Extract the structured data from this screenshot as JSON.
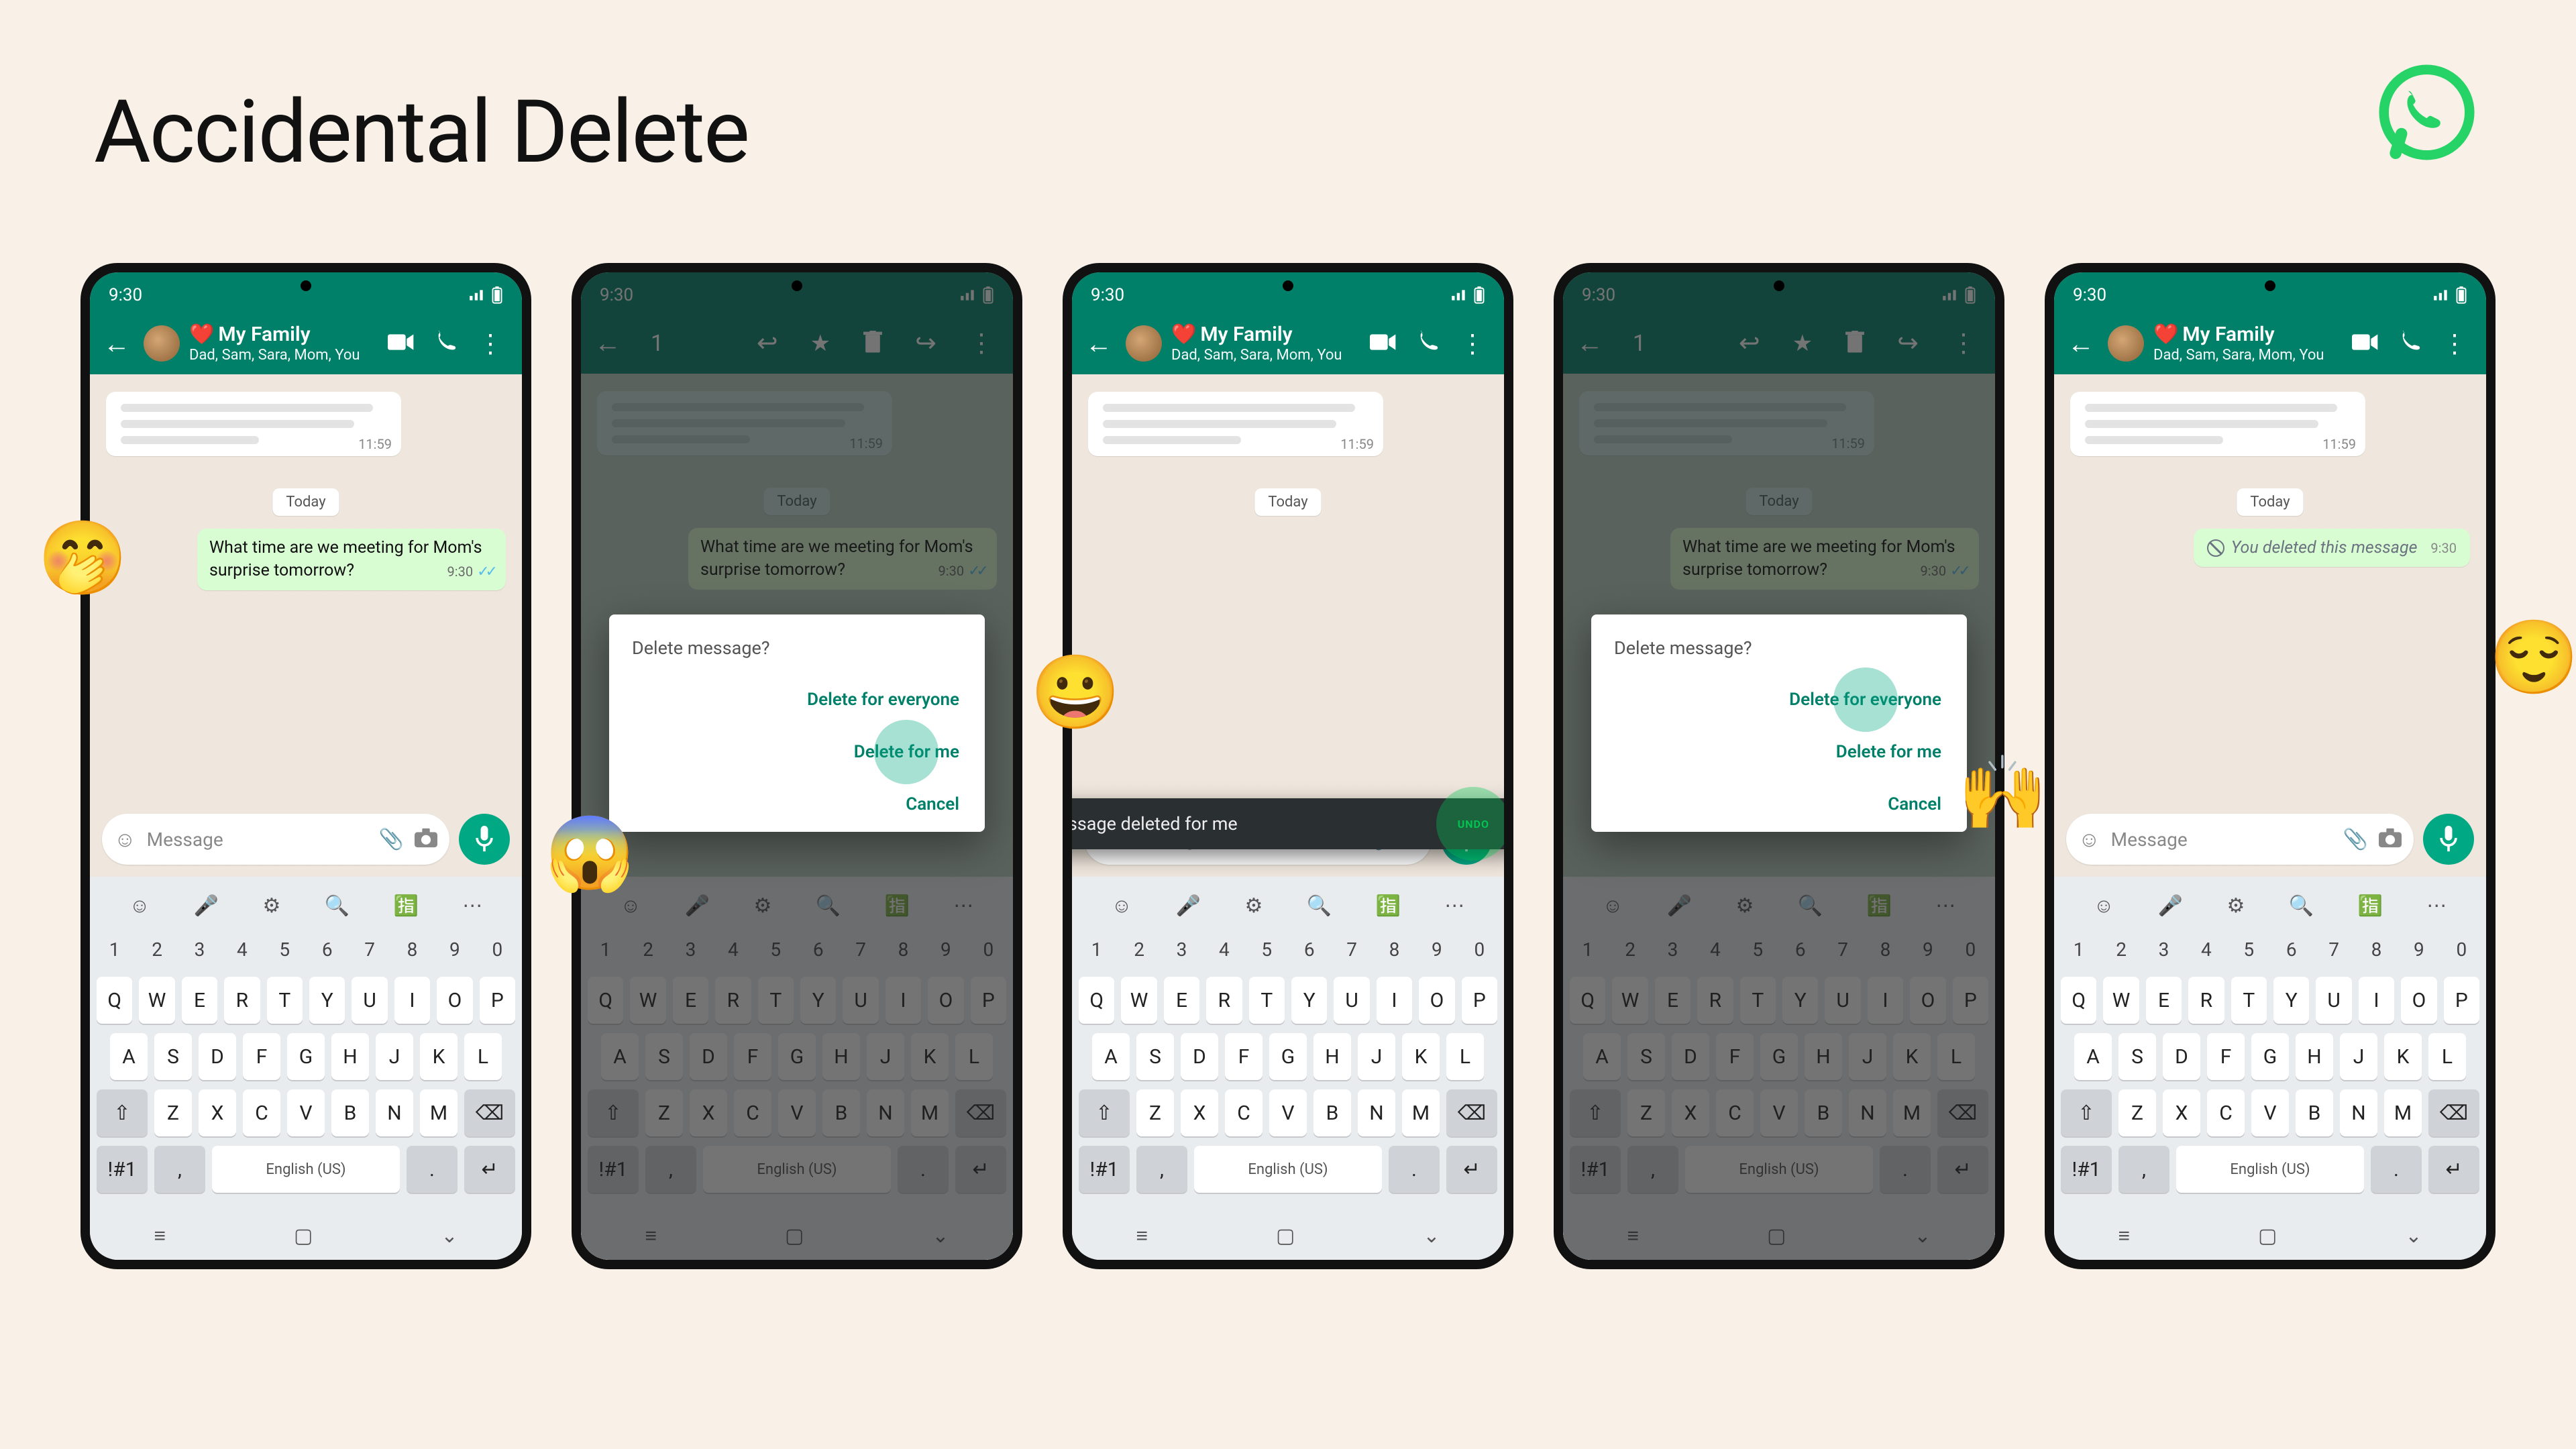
{
  "page_title": "Accidental Delete",
  "statusbar_time": "9:30",
  "chat": {
    "name": "My Family",
    "heart": "❤️",
    "members": "Dad, Sam, Sara, Mom, You"
  },
  "incoming_time": "11:59",
  "day_label": "Today",
  "outgoing_msg": "What time are we meeting for Mom's surprise tomorrow?",
  "outgoing_time": "9:30",
  "deleted_text": "You deleted this message",
  "deleted_time": "9:30",
  "composer_placeholder": "Message",
  "keyboard": {
    "numbers": [
      "1",
      "2",
      "3",
      "4",
      "5",
      "6",
      "7",
      "8",
      "9",
      "0"
    ],
    "row1": [
      "Q",
      "W",
      "E",
      "R",
      "T",
      "Y",
      "U",
      "I",
      "O",
      "P"
    ],
    "row2": [
      "A",
      "S",
      "D",
      "F",
      "G",
      "H",
      "J",
      "K",
      "L"
    ],
    "row3": [
      "Z",
      "X",
      "C",
      "V",
      "B",
      "N",
      "M"
    ],
    "lang": "English (US)",
    "sym": "!#1",
    "comma": ",",
    "period": "."
  },
  "selection_count": "1",
  "dialog": {
    "title": "Delete message?",
    "opt_everyone": "Delete for everyone",
    "opt_me": "Delete for me",
    "opt_cancel": "Cancel"
  },
  "snackbar": {
    "text": "Message deleted for me",
    "undo": "UNDO"
  },
  "emojis": {
    "p1": "🤭",
    "p2": "😱",
    "p3": "😀",
    "p4": "🙌",
    "p5": "😌"
  }
}
